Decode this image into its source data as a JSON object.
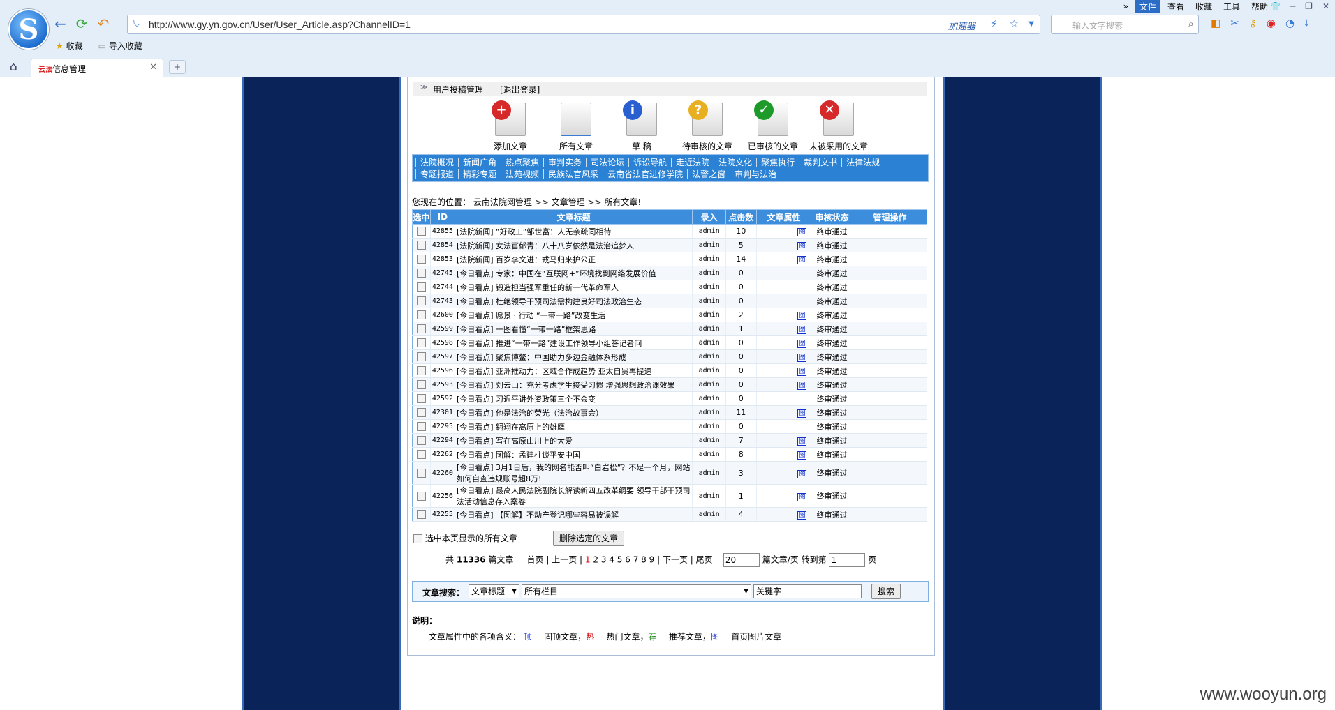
{
  "browser": {
    "menu": [
      "文件",
      "查看",
      "收藏",
      "工具",
      "帮助"
    ],
    "active_menu": "文件",
    "url": "http://www.gy.yn.gov.cn/User/User_Article.asp?ChannelID=1",
    "accelerator": "加速器",
    "search_placeholder": "输入文字搜索",
    "bookmarks": [
      "收藏",
      "导入收藏"
    ],
    "tab_title": "信息管理",
    "tab_favicon_text": "云法"
  },
  "panel": {
    "title": "用户投稿管理",
    "logout": "[退出登录]",
    "tools": [
      {
        "label": "添加文章",
        "badge": "+",
        "color": "#d62a2a"
      },
      {
        "label": "所有文章",
        "badge": "",
        "color": "#3a7bd5"
      },
      {
        "label": "草 稿",
        "badge": "i",
        "color": "#2a5fd0"
      },
      {
        "label": "待审核的文章",
        "badge": "?",
        "color": "#e8b020"
      },
      {
        "label": "已审核的文章",
        "badge": "✓",
        "color": "#1e9a2a"
      },
      {
        "label": "未被采用的文章",
        "badge": "✕",
        "color": "#d62a2a"
      }
    ],
    "categories_row1": [
      "法院概况",
      "新闻广角",
      "热点聚焦",
      "审判实务",
      "司法论坛",
      "诉讼导航",
      "走近法院",
      "法院文化",
      "聚焦执行",
      "裁判文书",
      "法律法规"
    ],
    "categories_row2": [
      "专题报道",
      "精彩专题",
      "法苑视频",
      "民族法官风采",
      "云南省法官进修学院",
      "法警之窗",
      "审判与法治"
    ],
    "breadcrumb": {
      "prefix": "您现在的位置：",
      "a": "云南法院网管理",
      "sep": ">>",
      "b": "文章管理",
      "c": "所有文章!"
    }
  },
  "table": {
    "headers": [
      "选中",
      "ID",
      "文章标题",
      "录入",
      "点击数",
      "文章属性",
      "审核状态",
      "管理操作"
    ],
    "rows": [
      {
        "id": "42855",
        "title": "[法院新闻] “好政工”邹世富：人无亲疏同相待",
        "author": "admin",
        "hits": "10",
        "pic": true,
        "status": "终审通过"
      },
      {
        "id": "42854",
        "title": "[法院新闻] 女法官郁青：八十八岁依然是法治追梦人",
        "author": "admin",
        "hits": "5",
        "pic": true,
        "status": "终审通过"
      },
      {
        "id": "42853",
        "title": "[法院新闻] 百岁李文进：戎马归来护公正",
        "author": "admin",
        "hits": "14",
        "pic": true,
        "status": "终审通过"
      },
      {
        "id": "42745",
        "title": "[今日看点] 专家：中国在“互联网+”环境找到网络发展价值",
        "author": "admin",
        "hits": "0",
        "pic": false,
        "status": "终审通过"
      },
      {
        "id": "42744",
        "title": "[今日看点] 锻造担当强军重任的新一代革命军人",
        "author": "admin",
        "hits": "0",
        "pic": false,
        "status": "终审通过"
      },
      {
        "id": "42743",
        "title": "[今日看点] 杜绝领导干预司法需构建良好司法政治生态",
        "author": "admin",
        "hits": "0",
        "pic": false,
        "status": "终审通过"
      },
      {
        "id": "42600",
        "title": "[今日看点] 愿景 · 行动 “一带一路”改变生活",
        "author": "admin",
        "hits": "2",
        "pic": true,
        "status": "终审通过"
      },
      {
        "id": "42599",
        "title": "[今日看点] 一图看懂“一带一路”框架思路",
        "author": "admin",
        "hits": "1",
        "pic": true,
        "status": "终审通过"
      },
      {
        "id": "42598",
        "title": "[今日看点] 推进“一带一路”建设工作领导小组答记者问",
        "author": "admin",
        "hits": "0",
        "pic": true,
        "status": "终审通过"
      },
      {
        "id": "42597",
        "title": "[今日看点] 聚焦博鳌：中国助力多边金融体系形成",
        "author": "admin",
        "hits": "0",
        "pic": true,
        "status": "终审通过"
      },
      {
        "id": "42596",
        "title": "[今日看点] 亚洲推动力：区域合作成趋势 亚太自贸再提速",
        "author": "admin",
        "hits": "0",
        "pic": true,
        "status": "终审通过"
      },
      {
        "id": "42593",
        "title": "[今日看点] 刘云山：充分考虑学生接受习惯 增强思想政治课效果",
        "author": "admin",
        "hits": "0",
        "pic": true,
        "status": "终审通过"
      },
      {
        "id": "42592",
        "title": "[今日看点] 习近平讲外资政策三个不会变",
        "author": "admin",
        "hits": "0",
        "pic": false,
        "status": "终审通过"
      },
      {
        "id": "42301",
        "title": "[今日看点] 他是法治的荧光（法治故事会）",
        "author": "admin",
        "hits": "11",
        "pic": true,
        "status": "终审通过"
      },
      {
        "id": "42295",
        "title": "[今日看点] 翱翔在高原上的雄鹰",
        "author": "admin",
        "hits": "0",
        "pic": false,
        "status": "终审通过"
      },
      {
        "id": "42294",
        "title": "[今日看点] 写在高原山川上的大爱",
        "author": "admin",
        "hits": "7",
        "pic": true,
        "status": "终审通过"
      },
      {
        "id": "42262",
        "title": "[今日看点] 图解：孟建柱谈平安中国",
        "author": "admin",
        "hits": "8",
        "pic": true,
        "status": "终审通过"
      },
      {
        "id": "42260",
        "title": "[今日看点] 3月1日后，我的网名能否叫“白岩松”？不足一个月，网站如何自查违规账号超8万!",
        "author": "admin",
        "hits": "3",
        "pic": true,
        "status": "终审通过"
      },
      {
        "id": "42256",
        "title": "[今日看点] 最高人民法院副院长解读新四五改革纲要 领导干部干预司法活动信息存入案卷",
        "author": "admin",
        "hits": "1",
        "pic": true,
        "status": "终审通过"
      },
      {
        "id": "42255",
        "title": "[今日看点] 【图解】不动产登记哪些容易被误解",
        "author": "admin",
        "hits": "4",
        "pic": true,
        "status": "终审通过"
      }
    ],
    "pic_mark": "图"
  },
  "actions": {
    "select_all": "选中本页显示的所有文章",
    "delete": "删除选定的文章"
  },
  "pager": {
    "total_prefix": "共",
    "total": "11336",
    "total_suffix": "篇文章",
    "first": "首页",
    "prev": "上一页",
    "current": "1",
    "pages": [
      "2",
      "3",
      "4",
      "5",
      "6",
      "7",
      "8",
      "9"
    ],
    "next": "下一页",
    "last": "尾页",
    "per_page": "20",
    "per_page_suffix": "篇文章/页",
    "goto_prefix": "转到第",
    "goto_value": "1",
    "goto_suffix": "页"
  },
  "search": {
    "label": "文章搜索：",
    "field": "文章标题",
    "scope": "所有栏目",
    "keyword": "关键字",
    "button": "搜索"
  },
  "notes": {
    "heading": "说明：",
    "prefix": "文章属性中的各项含义：",
    "items": [
      {
        "mark": "顶",
        "text": "----固顶文章，",
        "color": "#1030d0"
      },
      {
        "mark": "热",
        "text": "----热门文章，",
        "color": "#d00000"
      },
      {
        "mark": "荐",
        "text": "----推荐文章，",
        "color": "#108010"
      },
      {
        "mark": "图",
        "text": "----首页图片文章",
        "color": "#1030d0"
      }
    ]
  },
  "watermark": "www.wooyun.org"
}
